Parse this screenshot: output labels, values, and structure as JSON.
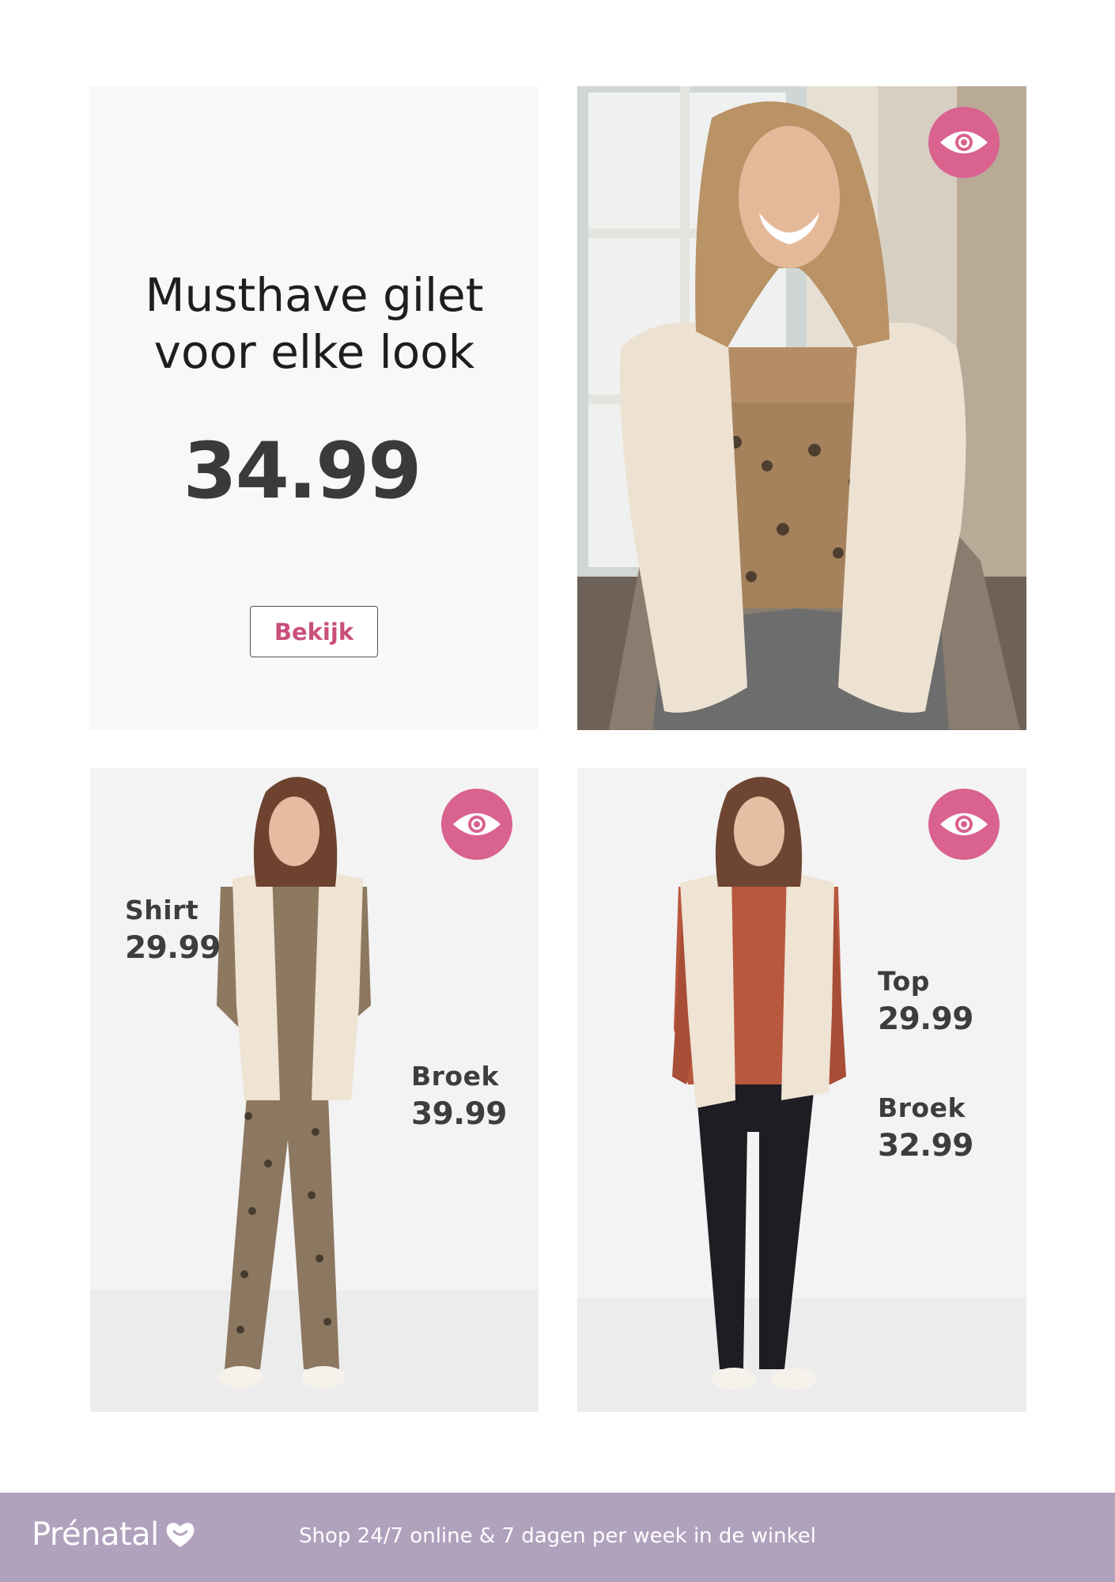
{
  "promo": {
    "headline_line1": "Musthave gilet",
    "headline_line2": "voor elke look",
    "price": "34.99",
    "cta_label": "Bekijk"
  },
  "look_left": {
    "item1": {
      "name": "Shirt",
      "price": "29.99"
    },
    "item2": {
      "name": "Broek",
      "price": "39.99"
    }
  },
  "look_right": {
    "item1": {
      "name": "Top",
      "price": "29.99"
    },
    "item2": {
      "name": "Broek",
      "price": "32.99"
    }
  },
  "footer": {
    "brand": "Prénatal",
    "tagline": "Shop 24/7 online & 7 dagen per week in de winkel"
  },
  "colors": {
    "accent_pink": "#d9628f",
    "cta_text": "#c94f7c",
    "footer_bg": "#b0a1bd"
  },
  "icons": [
    "eye-icon",
    "heart-logo-icon"
  ]
}
